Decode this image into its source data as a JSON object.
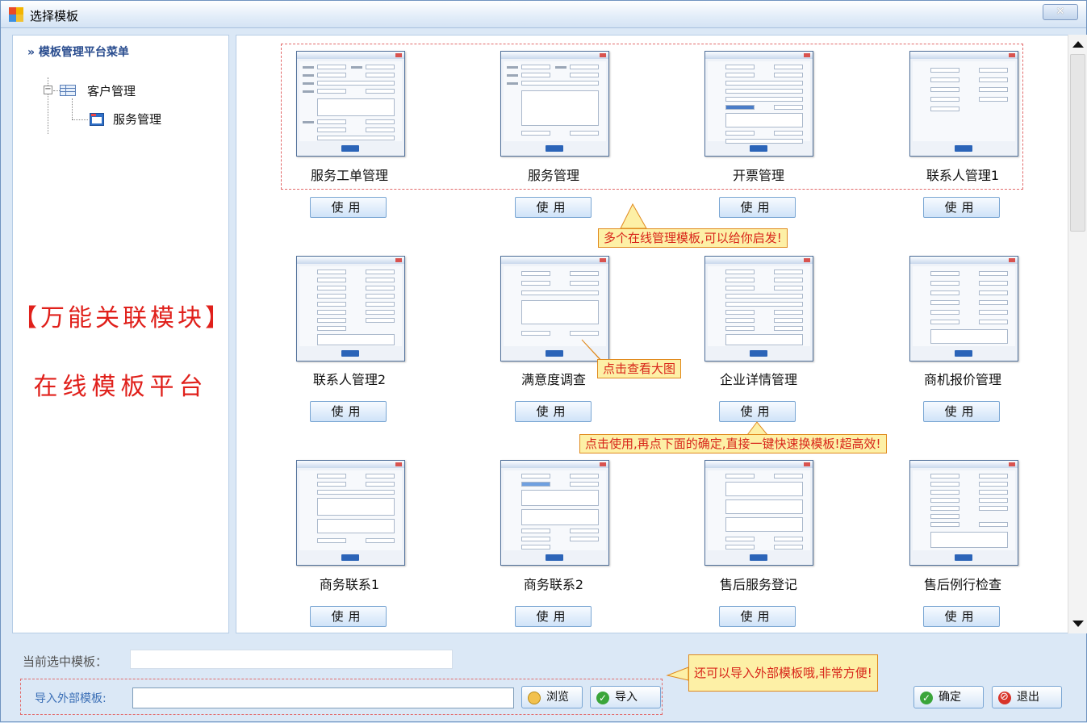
{
  "window": {
    "title": "选择模板",
    "close_label": "✕"
  },
  "sidebar": {
    "menu_title": "» 模板管理平台菜单",
    "tree": [
      {
        "label": "客户管理",
        "toggle": "−"
      },
      {
        "label": "服务管理"
      }
    ],
    "promo_line1": "【万能关联模块】",
    "promo_line2": "在线模板平台"
  },
  "templates": [
    {
      "name": "服务工单管理",
      "use_label": "使用"
    },
    {
      "name": "服务管理",
      "use_label": "使用"
    },
    {
      "name": "开票管理",
      "use_label": "使用"
    },
    {
      "name": "联系人管理1",
      "use_label": "使用"
    },
    {
      "name": "联系人管理2",
      "use_label": "使用"
    },
    {
      "name": "满意度调查",
      "use_label": "使用"
    },
    {
      "name": "企业详情管理",
      "use_label": "使用"
    },
    {
      "name": "商机报价管理",
      "use_label": "使用"
    },
    {
      "name": "商务联系1",
      "use_label": "使用"
    },
    {
      "name": "商务联系2",
      "use_label": "使用"
    },
    {
      "name": "售后服务登记",
      "use_label": "使用"
    },
    {
      "name": "售后例行检查",
      "use_label": "使用"
    }
  ],
  "callouts": {
    "multi": "多个在线管理模板,可以给你启发!",
    "click_big": "点击查看大图",
    "use_then_ok": "点击使用,再点下面的确定,直接一键快速换模板!超高效!",
    "import": "还可以导入外部模板哦,非常方便!"
  },
  "footer": {
    "selected_label": "当前选中模板：",
    "selected_value": "",
    "import_label": "导入外部模板:",
    "import_value": "",
    "browse_label": "浏览",
    "import_btn_label": "导入",
    "ok_label": "确定",
    "exit_label": "退出"
  }
}
